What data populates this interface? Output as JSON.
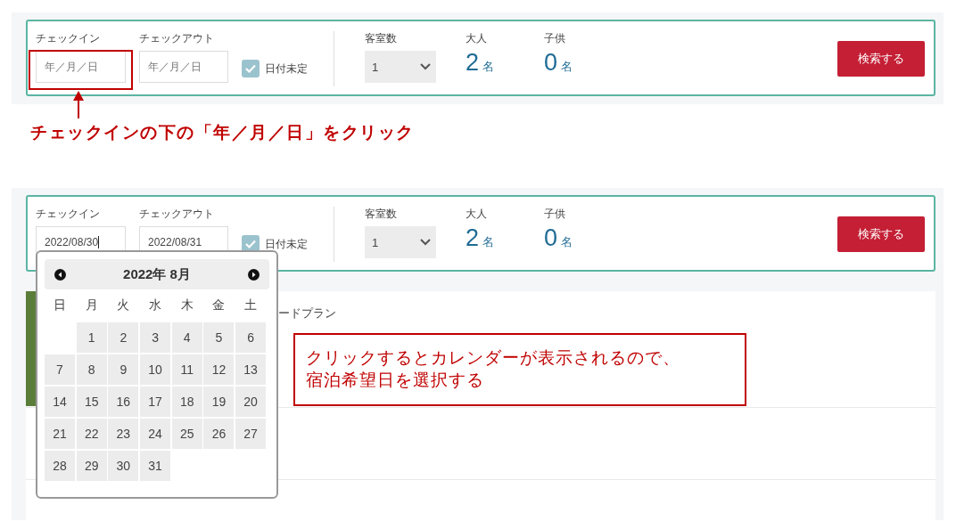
{
  "step1": {
    "search_bar": {
      "checkin": {
        "label": "チェックイン",
        "placeholder": "年／月／日",
        "highlighted": true,
        "focused": false
      },
      "checkout": {
        "label": "チェックアウト",
        "placeholder": "年／月／日",
        "highlighted": false,
        "focused": false
      },
      "date_undecided": {
        "label": "日付未定",
        "checked": true
      },
      "rooms": {
        "label": "客室数",
        "value": "1"
      },
      "adults": {
        "label": "大人",
        "count": "2",
        "unit": "名"
      },
      "children": {
        "label": "子供",
        "count": "0",
        "unit": "名"
      },
      "button": "検索する"
    },
    "caption": "チェックインの下の「年／月／日」をクリック"
  },
  "step2": {
    "search_bar": {
      "checkin": {
        "label": "チェックイン",
        "value": "2022/08/30",
        "highlighted": false,
        "focused": true
      },
      "checkout": {
        "label": "チェックアウト",
        "value": "2022/08/31",
        "highlighted": false,
        "focused": false
      },
      "date_undecided": {
        "label": "日付未定",
        "checked": true
      },
      "rooms": {
        "label": "客室数",
        "value": "1"
      },
      "adults": {
        "label": "大人",
        "count": "2",
        "unit": "名"
      },
      "children": {
        "label": "子供",
        "count": "0",
        "unit": "名"
      },
      "button": "検索する"
    },
    "calendar": {
      "title": "2022年 8月",
      "weekdays": [
        "日",
        "月",
        "火",
        "水",
        "木",
        "金",
        "土"
      ],
      "weeks": [
        [
          {
            "kind": "blank"
          },
          {
            "kind": "day",
            "label": "1"
          },
          {
            "kind": "day",
            "label": "2"
          },
          {
            "kind": "day",
            "label": "3"
          },
          {
            "kind": "day",
            "label": "4"
          },
          {
            "kind": "day",
            "label": "5"
          },
          {
            "kind": "day",
            "label": "6"
          }
        ],
        [
          {
            "kind": "day",
            "label": "7"
          },
          {
            "kind": "day",
            "label": "8"
          },
          {
            "kind": "day",
            "label": "9"
          },
          {
            "kind": "day",
            "label": "10"
          },
          {
            "kind": "day",
            "label": "11"
          },
          {
            "kind": "day",
            "label": "12"
          },
          {
            "kind": "day",
            "label": "13"
          }
        ],
        [
          {
            "kind": "day",
            "label": "14"
          },
          {
            "kind": "day",
            "label": "15"
          },
          {
            "kind": "day",
            "label": "16"
          },
          {
            "kind": "day",
            "label": "17"
          },
          {
            "kind": "day",
            "label": "18"
          },
          {
            "kind": "day",
            "label": "19"
          },
          {
            "kind": "day",
            "label": "20"
          }
        ],
        [
          {
            "kind": "day",
            "label": "21"
          },
          {
            "kind": "day",
            "label": "22"
          },
          {
            "kind": "day",
            "label": "23"
          },
          {
            "kind": "day",
            "label": "24"
          },
          {
            "kind": "day",
            "label": "25"
          },
          {
            "kind": "day",
            "label": "26"
          },
          {
            "kind": "day",
            "label": "27"
          }
        ],
        [
          {
            "kind": "day",
            "label": "28"
          },
          {
            "kind": "day",
            "label": "29"
          },
          {
            "kind": "day",
            "label": "30"
          },
          {
            "kind": "day",
            "label": "31"
          },
          {
            "kind": "blank"
          },
          {
            "kind": "blank"
          },
          {
            "kind": "blank"
          }
        ]
      ]
    },
    "plan_list": {
      "rows": [
        {
          "title": "ードプラン"
        }
      ]
    },
    "callout": "クリックするとカレンダーが表示されるので、宿泊希望日を選択する"
  }
}
